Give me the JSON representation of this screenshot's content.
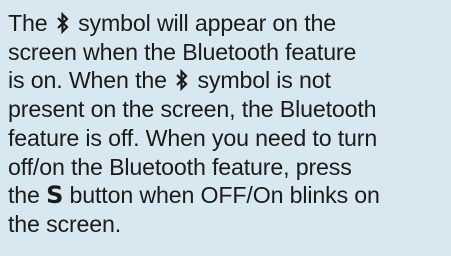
{
  "paragraph": {
    "line1": {
      "before": "The ",
      "after": " symbol will appear on the"
    },
    "line2": "screen when the Bluetooth feature",
    "line3": {
      "before": "is on. When the ",
      "after": " symbol is not"
    },
    "line4": "present on the screen, the Bluetooth",
    "line5": "feature is off. When you need to turn",
    "line6": "off/on the Bluetooth feature, press",
    "line7": {
      "before": "the ",
      "key": "S",
      "after": " button when OFF/On blinks on"
    },
    "line8": "the screen."
  },
  "icons": {
    "bluetooth": "bluetooth-icon"
  },
  "colors": {
    "background": "#d8e8f0",
    "text": "#1b1b1b"
  }
}
